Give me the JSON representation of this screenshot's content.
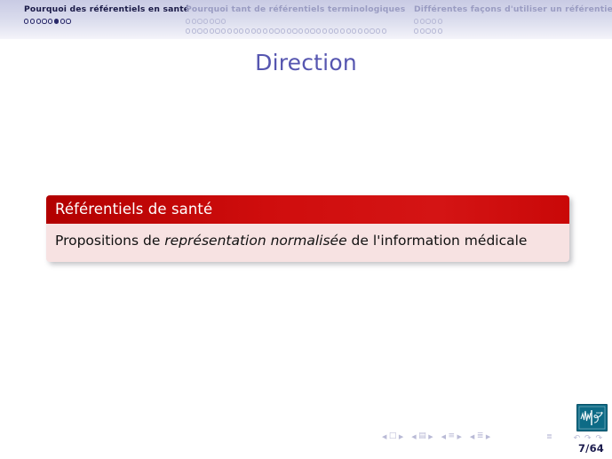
{
  "navbar": {
    "sections": [
      {
        "id": "sec1",
        "title": "Pourquoi des référentiels en santé",
        "active": true,
        "rows": [
          {
            "count": 8,
            "filled_index": 5
          }
        ]
      },
      {
        "id": "sec2",
        "title": "Pourquoi tant de référentiels terminologiques",
        "active": false,
        "rows": [
          {
            "count": 7,
            "filled_index": -1
          },
          {
            "count": 34,
            "filled_index": -1
          }
        ]
      },
      {
        "id": "sec3",
        "title": "Différentes façons d'utiliser un référentiel",
        "active": false,
        "rows": [
          {
            "count": 5,
            "filled_index": -1
          },
          {
            "count": 5,
            "filled_index": -1
          }
        ]
      }
    ]
  },
  "slide": {
    "title": "Direction",
    "block": {
      "title": "Référentiels de santé",
      "body_before": "Propositions de ",
      "body_emphasis": "représentation normalisée",
      "body_after": " de l'information médicale"
    }
  },
  "footer": {
    "page_number": "7/64",
    "nav_symbols": [
      "◀",
      "□",
      "▶",
      "◀",
      "▤",
      "▶",
      "◀",
      "≡",
      "▶",
      "◀",
      "≣",
      "▶",
      "≣"
    ],
    "mini_nav": "↶ ↷ ↷",
    "logo_name": "institution-logo"
  },
  "colors": {
    "block_title_bg": "#c90808",
    "block_body_bg": "#f7e2e2",
    "frame_title": "#5656b0",
    "nav_active": "#191946",
    "nav_inactive": "#9a9cc2",
    "header_bg": "#d2d4e9"
  }
}
